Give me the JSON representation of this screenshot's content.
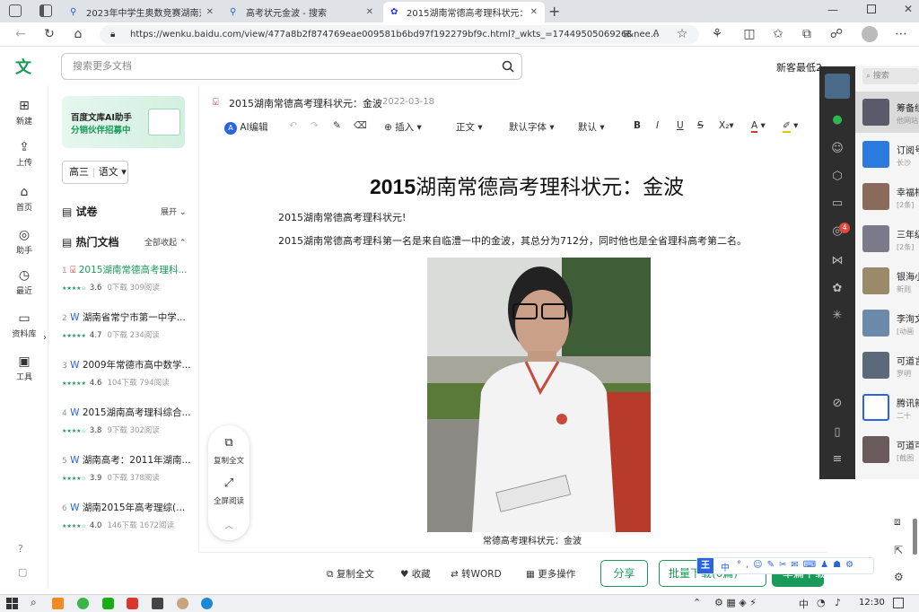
{
  "browser": {
    "tabs": [
      {
        "label": "2023年中学生奥数竞赛湖南对获",
        "icon": "search-icon"
      },
      {
        "label": "高考状元金波 - 搜索",
        "icon": "search-icon"
      },
      {
        "label": "2015湖南常德高考理科状元：金",
        "icon": "paw-icon"
      }
    ],
    "url": "https://wenku.baidu.com/view/477a8b2f874769eae009581b6bd97f192279bf9c.html?_wkts_=1744950506926&nee..."
  },
  "header": {
    "logo": "文",
    "search_placeholder": "搜索更多文档",
    "promo": "新客最低2"
  },
  "rail": {
    "items": [
      {
        "label": "新建",
        "icon": "plus-icon"
      },
      {
        "label": "上传",
        "icon": "upload-icon"
      },
      {
        "label": "首页",
        "icon": "home-icon"
      },
      {
        "label": "助手",
        "icon": "assistant-icon"
      },
      {
        "label": "最近",
        "icon": "clock-icon"
      },
      {
        "label": "资料库",
        "icon": "folder-icon"
      },
      {
        "label": "工具",
        "icon": "toolbox-icon"
      }
    ]
  },
  "panel": {
    "banner_line1": "百度文库AI助手",
    "banner_line2": "分销伙伴招募中",
    "grade": "高三",
    "subject": "语文",
    "section_exam": "试卷",
    "expand": "展开",
    "section_hot": "热门文档",
    "collapse_all": "全部收起",
    "docs": [
      {
        "num": "1",
        "title": "2015湖南常德高考理科...",
        "rating": "3.6",
        "downloads": "0下载",
        "reads": "309阅读",
        "type": "pdf"
      },
      {
        "num": "2",
        "title": "湖南省常宁市第一中学...",
        "rating": "4.7",
        "downloads": "0下载",
        "reads": "234阅读",
        "type": "word"
      },
      {
        "num": "3",
        "title": "2009年常德市高中数学...",
        "rating": "4.6",
        "downloads": "104下载",
        "reads": "794阅读",
        "type": "word"
      },
      {
        "num": "4",
        "title": "2015湖南高考理科综合...",
        "rating": "3.8",
        "downloads": "9下载",
        "reads": "302阅读",
        "type": "word"
      },
      {
        "num": "5",
        "title": "湖南高考：2011年湖南...",
        "rating": "3.9",
        "downloads": "0下载",
        "reads": "378阅读",
        "type": "word"
      },
      {
        "num": "6",
        "title": "湖南2015年高考理综(...",
        "rating": "4.0",
        "downloads": "146下载",
        "reads": "1672阅读",
        "type": "word"
      }
    ]
  },
  "doc": {
    "file_title": "2015湖南常德高考理科状元：金波",
    "date": "2022-03-18",
    "toolbar": {
      "ai_edit": "AI编辑",
      "insert": "插入",
      "style": "正文",
      "font": "默认字体",
      "size": "默认"
    },
    "heading_latin": "2015",
    "heading_rest": "湖南常德高考理科状元：金波",
    "para1": "2015湖南常德高考理科状元!",
    "para2": "2015湖南常德高考理科第一名是来自临澧一中的金波，其总分为712分，同时他也是全省理科高考第二名。",
    "caption": "常德高考理科状元：金波"
  },
  "float_tools": {
    "copy_all": "复制全文",
    "fullscreen": "全屏阅读"
  },
  "bottom_bar": {
    "copy": "复制全文",
    "favorite": "收藏",
    "to_word": "转WORD",
    "more": "更多操作",
    "share": "分享",
    "batch": "批量下载(6篇)",
    "single": "单篇下载"
  },
  "social": {
    "search": "搜索",
    "badge": "4",
    "chats": [
      {
        "name": "筹备组",
        "preview": "他网站"
      },
      {
        "name": "订阅号",
        "preview": "长沙"
      },
      {
        "name": "幸福相",
        "preview": "[2条]"
      },
      {
        "name": "三年级",
        "preview": "[2条]"
      },
      {
        "name": "银海小",
        "preview": "新则"
      },
      {
        "name": "李洵文",
        "preview": "[动画"
      },
      {
        "name": "可道言",
        "preview": "罗明"
      },
      {
        "name": "腾讯新",
        "preview": "二十"
      },
      {
        "name": "可道可",
        "preview": "[截图"
      }
    ]
  },
  "ime": {
    "lang": "中"
  },
  "taskbar": {
    "ime": "中",
    "time": "12:30"
  },
  "colors": {
    "brand_green": "#1a9b59",
    "wps_red": "#d9372b",
    "ai_blue": "#2a64e0"
  }
}
